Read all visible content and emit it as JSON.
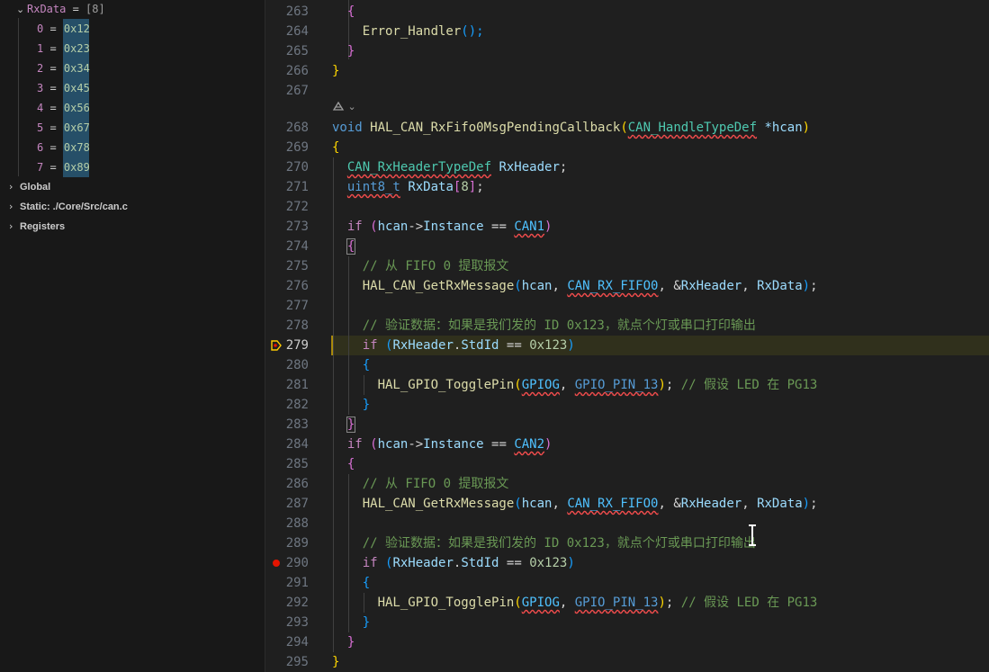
{
  "variables": {
    "rxdata": {
      "name": "RxData",
      "equals": " = ",
      "value": "[8]"
    },
    "elements": [
      {
        "index": "0",
        "value": "0x12"
      },
      {
        "index": "1",
        "value": "0x23"
      },
      {
        "index": "2",
        "value": "0x34"
      },
      {
        "index": "3",
        "value": "0x45"
      },
      {
        "index": "4",
        "value": "0x56"
      },
      {
        "index": "5",
        "value": "0x67"
      },
      {
        "index": "6",
        "value": "0x78"
      },
      {
        "index": "7",
        "value": "0x89"
      }
    ],
    "scopes": [
      "Global",
      "Static: ./Core/Src/can.c",
      "Registers"
    ]
  },
  "editor": {
    "line_numbers": [
      "263",
      "264",
      "265",
      "266",
      "267",
      "268",
      "269",
      "270",
      "271",
      "272",
      "273",
      "274",
      "275",
      "276",
      "277",
      "278",
      "279",
      "280",
      "281",
      "282",
      "283",
      "284",
      "285",
      "286",
      "287",
      "288",
      "289",
      "290",
      "291",
      "292",
      "293",
      "294",
      "295"
    ],
    "current_line": "279",
    "breakpoint_line": "290",
    "code": {
      "l263_brace": "{",
      "l264_fn": "Error_Handler",
      "l264_rest": "();",
      "l265_brace": "}",
      "l266_brace": "}",
      "l268_void": "void",
      "l268_fn": "HAL_CAN_RxFifo0MsgPendingCallback",
      "l268_type": "CAN_HandleTypeDef",
      "l268_param": "*hcan",
      "l269_brace": "{",
      "l270_type": "CAN_RxHeaderTypeDef",
      "l270_var": "RxHeader",
      "l271_type": "uint8_t",
      "l271_var": "RxData",
      "l271_num": "8",
      "if_kw": "if",
      "hcan": "hcan",
      "arrow": "->",
      "instance": "Instance",
      "eq": " == ",
      "can1": "CAN1",
      "can2": "CAN2",
      "comment_fifo": "// 从 FIFO 0 提取报文",
      "get_fn": "HAL_CAN_GetRxMessage",
      "fifo0": "CAN_RX_FIFO0",
      "amp_rxheader": "RxHeader",
      "rxdata": "RxData",
      "comment_verify": "// 验证数据：如果是我们发的 ID 0x123，就点个灯或串口打印输出",
      "rxheader": "RxHeader",
      "stdid": "StdId",
      "hex123": "0x123",
      "toggle_fn": "HAL_GPIO_TogglePin",
      "gpiog": "GPIOG",
      "pin13": "GPIO_PIN_13",
      "comment_led": "// 假设 LED 在 PG13"
    }
  }
}
